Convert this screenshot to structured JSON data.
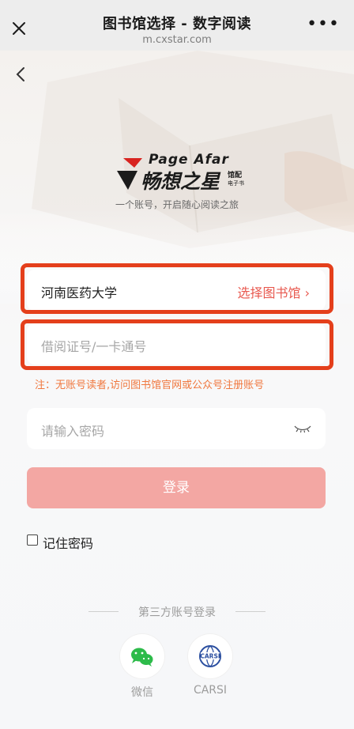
{
  "topbar": {
    "title": "图书馆选择 - 数字阅读",
    "url": "m.cxstar.com",
    "more": "•••"
  },
  "brand": {
    "name_en": "Page Afar",
    "name_cn": "畅想之星",
    "tag1": "馆配",
    "tag2": "电子书",
    "slogan": "一个账号，开启随心阅读之旅"
  },
  "form": {
    "library_value": "河南医药大学",
    "library_action": "选择图书馆 ›",
    "account_placeholder": "借阅证号/一卡通号",
    "note": "注：无账号读者,访问图书馆官网或公众号注册账号",
    "password_placeholder": "请输入密码",
    "login_label": "登录",
    "remember_label": "记住密码"
  },
  "third_party": {
    "title": "第三方账号登录",
    "wechat_label": "微信",
    "carsi_label": "CARSI",
    "carsi_icon_text": "CARSI"
  },
  "colors": {
    "accent": "#e8594f",
    "highlight": "#e43f1b",
    "login_button": "#f3a7a3",
    "wechat_green": "#2dbb4a",
    "carsi_blue": "#2b4fa0"
  }
}
